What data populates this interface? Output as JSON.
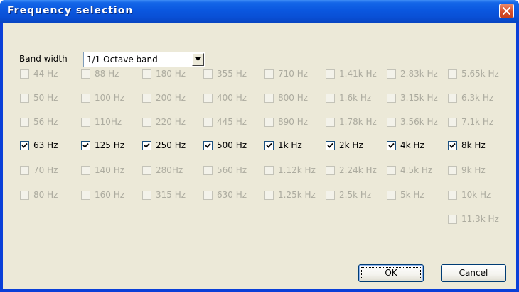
{
  "window": {
    "title": "Frequency selection"
  },
  "bandwidth": {
    "label": "Band width",
    "selected": "1/1 Octave band"
  },
  "columns": [
    {
      "items": [
        {
          "label": "44 Hz",
          "checked": false,
          "enabled": false
        },
        {
          "label": "50 Hz",
          "checked": false,
          "enabled": false
        },
        {
          "label": "56 Hz",
          "checked": false,
          "enabled": false
        },
        {
          "label": "63 Hz",
          "checked": true,
          "enabled": true
        },
        {
          "label": "70 Hz",
          "checked": false,
          "enabled": false
        },
        {
          "label": "80 Hz",
          "checked": false,
          "enabled": false
        }
      ]
    },
    {
      "items": [
        {
          "label": "88 Hz",
          "checked": false,
          "enabled": false
        },
        {
          "label": "100 Hz",
          "checked": false,
          "enabled": false
        },
        {
          "label": "110Hz",
          "checked": false,
          "enabled": false
        },
        {
          "label": "125 Hz",
          "checked": true,
          "enabled": true
        },
        {
          "label": "140 Hz",
          "checked": false,
          "enabled": false
        },
        {
          "label": "160 Hz",
          "checked": false,
          "enabled": false
        }
      ]
    },
    {
      "items": [
        {
          "label": "180 Hz",
          "checked": false,
          "enabled": false
        },
        {
          "label": "200 Hz",
          "checked": false,
          "enabled": false
        },
        {
          "label": "220 Hz",
          "checked": false,
          "enabled": false
        },
        {
          "label": "250 Hz",
          "checked": true,
          "enabled": true
        },
        {
          "label": "280Hz",
          "checked": false,
          "enabled": false
        },
        {
          "label": "315 Hz",
          "checked": false,
          "enabled": false
        }
      ]
    },
    {
      "items": [
        {
          "label": "355 Hz",
          "checked": false,
          "enabled": false
        },
        {
          "label": "400 Hz",
          "checked": false,
          "enabled": false
        },
        {
          "label": "445 Hz",
          "checked": false,
          "enabled": false
        },
        {
          "label": "500 Hz",
          "checked": true,
          "enabled": true
        },
        {
          "label": "560 Hz",
          "checked": false,
          "enabled": false
        },
        {
          "label": "630 Hz",
          "checked": false,
          "enabled": false
        }
      ]
    },
    {
      "items": [
        {
          "label": "710 Hz",
          "checked": false,
          "enabled": false
        },
        {
          "label": "800 Hz",
          "checked": false,
          "enabled": false
        },
        {
          "label": "890 Hz",
          "checked": false,
          "enabled": false
        },
        {
          "label": "1k Hz",
          "checked": true,
          "enabled": true
        },
        {
          "label": "1.12k Hz",
          "checked": false,
          "enabled": false
        },
        {
          "label": "1.25k Hz",
          "checked": false,
          "enabled": false
        }
      ]
    },
    {
      "items": [
        {
          "label": "1.41k Hz",
          "checked": false,
          "enabled": false
        },
        {
          "label": "1.6k Hz",
          "checked": false,
          "enabled": false
        },
        {
          "label": "1.78k Hz",
          "checked": false,
          "enabled": false
        },
        {
          "label": "2k Hz",
          "checked": true,
          "enabled": true
        },
        {
          "label": "2.24k Hz",
          "checked": false,
          "enabled": false
        },
        {
          "label": "2.5k Hz",
          "checked": false,
          "enabled": false
        }
      ]
    },
    {
      "items": [
        {
          "label": "2.83k Hz",
          "checked": false,
          "enabled": false
        },
        {
          "label": "3.15k Hz",
          "checked": false,
          "enabled": false
        },
        {
          "label": "3.56k Hz",
          "checked": false,
          "enabled": false
        },
        {
          "label": "4k Hz",
          "checked": true,
          "enabled": true
        },
        {
          "label": "4.5k Hz",
          "checked": false,
          "enabled": false
        },
        {
          "label": "5k Hz",
          "checked": false,
          "enabled": false
        }
      ]
    },
    {
      "items": [
        {
          "label": "5.65k Hz",
          "checked": false,
          "enabled": false
        },
        {
          "label": "6.3k Hz",
          "checked": false,
          "enabled": false
        },
        {
          "label": "7.1k Hz",
          "checked": false,
          "enabled": false
        },
        {
          "label": "8k Hz",
          "checked": true,
          "enabled": true
        },
        {
          "label": "9k Hz",
          "checked": false,
          "enabled": false
        },
        {
          "label": "10k Hz",
          "checked": false,
          "enabled": false
        },
        {
          "label": "11.3k Hz",
          "checked": false,
          "enabled": false
        }
      ]
    }
  ],
  "buttons": {
    "ok": "OK",
    "cancel": "Cancel"
  }
}
